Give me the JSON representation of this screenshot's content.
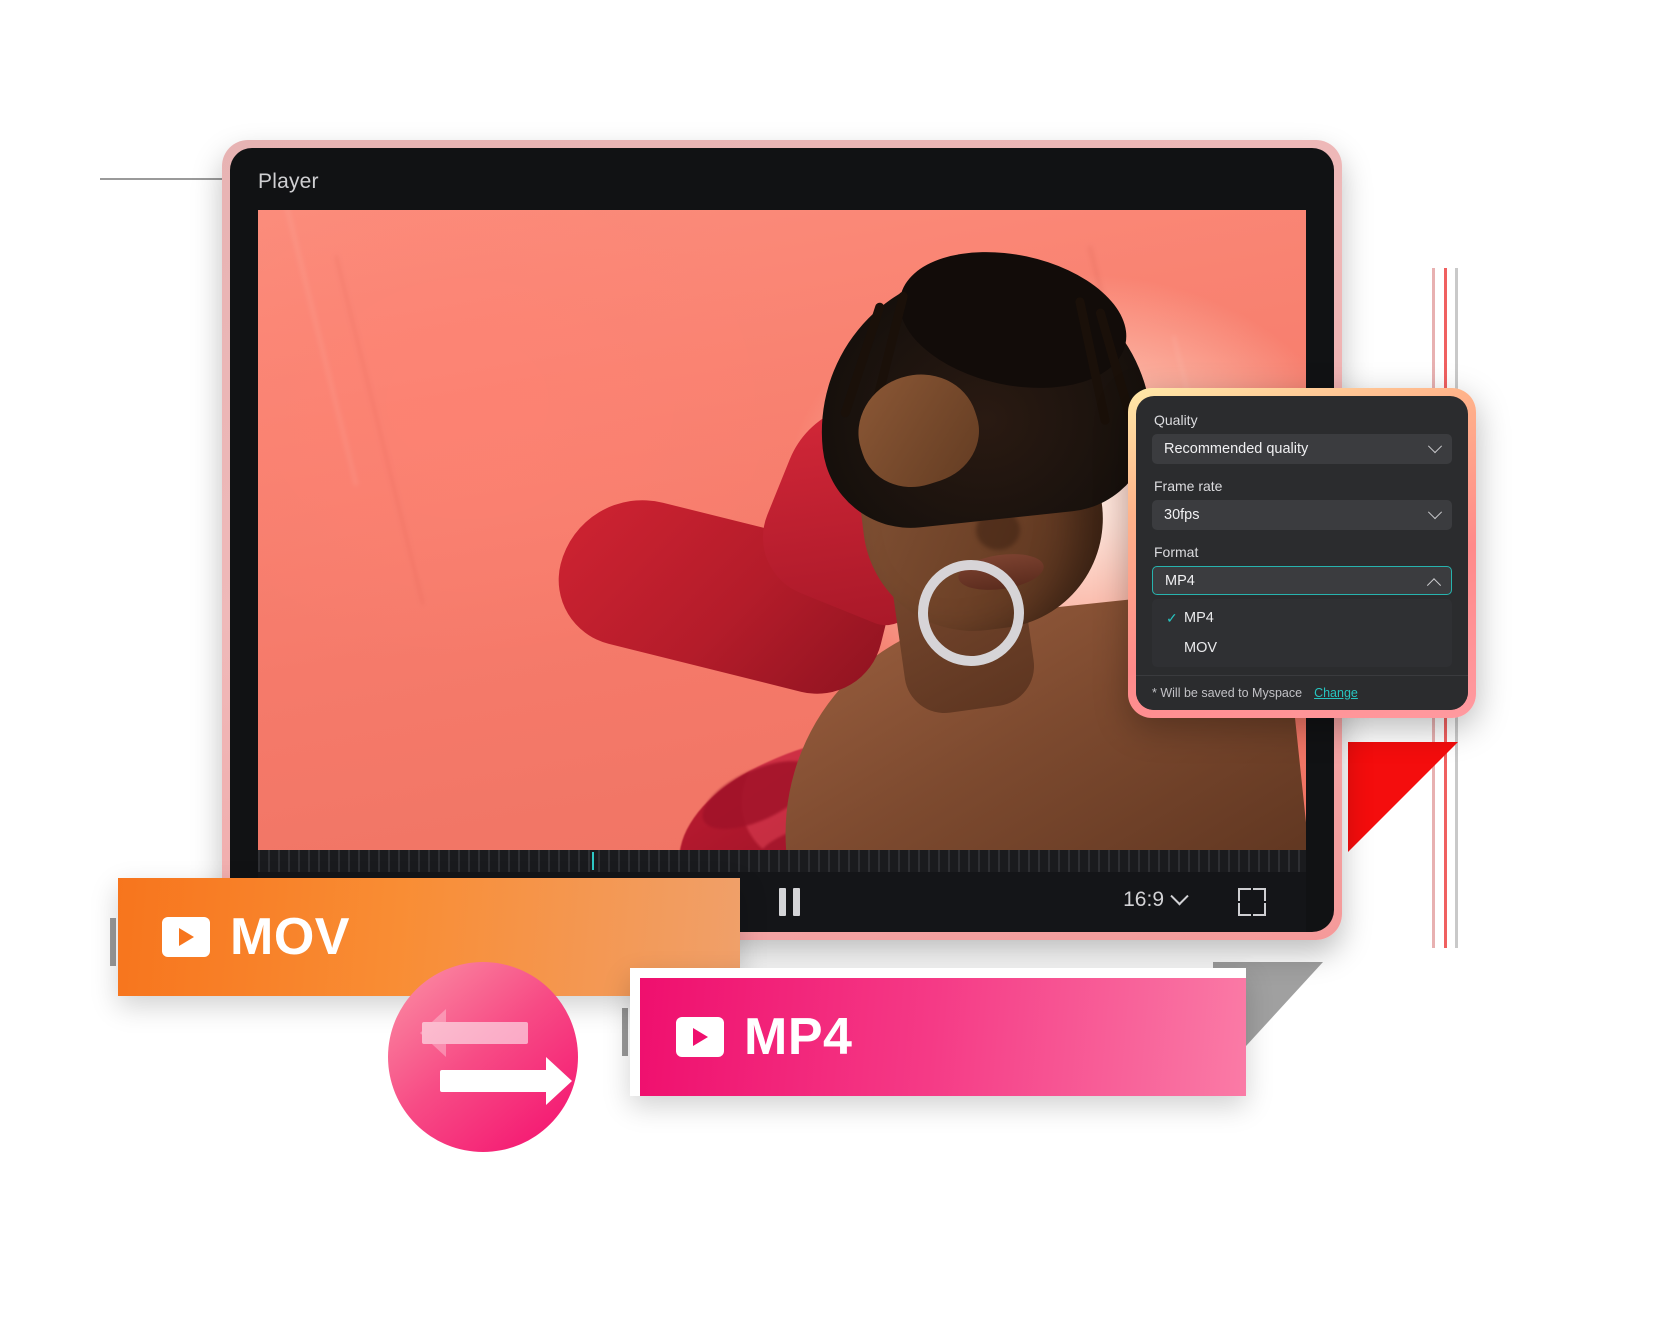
{
  "device": {
    "title": "Player"
  },
  "player_controls": {
    "pause_label": "Pause",
    "aspect_ratio": "16:9",
    "fullscreen_label": "Fullscreen"
  },
  "settings": {
    "quality": {
      "label": "Quality",
      "value": "Recommended quality"
    },
    "frame_rate": {
      "label": "Frame rate",
      "value": "30fps"
    },
    "format": {
      "label": "Format",
      "value": "MP4",
      "options": [
        {
          "label": "MP4",
          "selected": true
        },
        {
          "label": "MOV",
          "selected": false
        }
      ],
      "check_glyph": "✓"
    },
    "footer": {
      "note": "* Will be saved to Myspace",
      "change_link": "Change"
    }
  },
  "badges": [
    {
      "label": "MOV",
      "icon": "video-file-icon"
    },
    {
      "label": "MP4",
      "icon": "video-file-icon"
    }
  ],
  "swap": {
    "label": "swap-formats-icon"
  },
  "colors": {
    "accent_teal": "#27c4c0",
    "badge_orange": "#f7751d",
    "badge_pink": "#ef0f6e",
    "panel_bg": "#2b2c2e",
    "device_bg": "#111214",
    "red_triangle": "#f40d0d"
  }
}
